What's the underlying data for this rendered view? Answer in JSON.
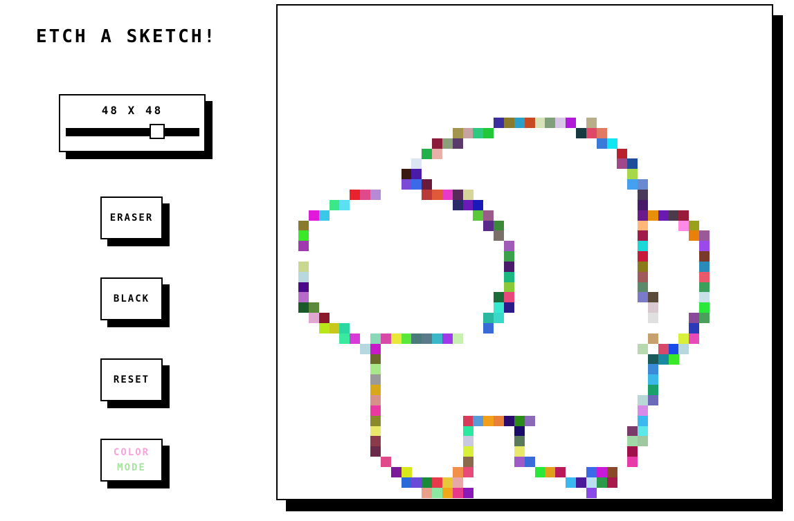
{
  "app": {
    "title": "ETCH A SKETCH!"
  },
  "grid_control": {
    "label": "48 X 48",
    "value": 48,
    "min": 1,
    "max": 100
  },
  "buttons": {
    "eraser": "ERASER",
    "black": "BLACK",
    "reset": "RESET",
    "color_mode_line1": "COLOR",
    "color_mode_line2": "MODE"
  },
  "colors": {
    "ink": "#000000",
    "background": "#ffffff"
  },
  "drawing": {
    "grid_size": 48,
    "cells": [
      [
        19,
        11,
        "#3b2f9e"
      ],
      [
        20,
        11,
        "#8a7a2e"
      ],
      [
        21,
        11,
        "#2aa0c8"
      ],
      [
        22,
        11,
        "#c84a22"
      ],
      [
        23,
        11,
        "#d6e2b8"
      ],
      [
        24,
        11,
        "#7fa07a"
      ],
      [
        25,
        11,
        "#d8c6e6"
      ],
      [
        26,
        11,
        "#b01ad8"
      ],
      [
        27,
        11,
        "#ffffff"
      ],
      [
        28,
        11,
        "#b8ae8a"
      ],
      [
        15,
        12,
        "#a3954e"
      ],
      [
        16,
        12,
        "#c8a2a0"
      ],
      [
        17,
        12,
        "#2ec880"
      ],
      [
        18,
        12,
        "#22c838"
      ],
      [
        27,
        12,
        "#173a40"
      ],
      [
        28,
        12,
        "#e04868"
      ],
      [
        29,
        12,
        "#e07a62"
      ],
      [
        13,
        13,
        "#8a1c3a"
      ],
      [
        14,
        13,
        "#8aa07a"
      ],
      [
        15,
        13,
        "#5a3a6a"
      ],
      [
        29,
        13,
        "#3a7ad8"
      ],
      [
        30,
        13,
        "#12e6f0"
      ],
      [
        12,
        14,
        "#22b04a"
      ],
      [
        13,
        14,
        "#e8b0a8"
      ],
      [
        31,
        14,
        "#b8222e"
      ],
      [
        11,
        15,
        "#dce6f2"
      ],
      [
        31,
        15,
        "#a0488a"
      ],
      [
        32,
        15,
        "#1e4e9a"
      ],
      [
        10,
        16,
        "#3a1a10"
      ],
      [
        11,
        16,
        "#4a1aa8"
      ],
      [
        32,
        16,
        "#a8d84a"
      ],
      [
        10,
        17,
        "#7a4ad6"
      ],
      [
        11,
        17,
        "#3a6ae8"
      ],
      [
        12,
        17,
        "#6a1a3a"
      ],
      [
        32,
        17,
        "#46a0f0"
      ],
      [
        33,
        17,
        "#6a8ad0"
      ],
      [
        5,
        18,
        "#e8222e"
      ],
      [
        6,
        18,
        "#e04a8a"
      ],
      [
        7,
        18,
        "#b88ad6"
      ],
      [
        12,
        18,
        "#b83a3a"
      ],
      [
        13,
        18,
        "#e05a3a"
      ],
      [
        14,
        18,
        "#e83ac8"
      ],
      [
        15,
        18,
        "#5a2a5a"
      ],
      [
        16,
        18,
        "#d6d69a"
      ],
      [
        33,
        18,
        "#4a3a5a"
      ],
      [
        3,
        19,
        "#3ae88a"
      ],
      [
        4,
        19,
        "#5ae0f0"
      ],
      [
        15,
        19,
        "#2a2a6a"
      ],
      [
        16,
        19,
        "#6a1ab8"
      ],
      [
        17,
        19,
        "#1a1ab8"
      ],
      [
        33,
        19,
        "#4a1a6a"
      ],
      [
        1,
        20,
        "#e01ad8"
      ],
      [
        2,
        20,
        "#3ac8e8"
      ],
      [
        17,
        20,
        "#5ac83a"
      ],
      [
        18,
        20,
        "#9a5a8a"
      ],
      [
        33,
        20,
        "#6a1a8a"
      ],
      [
        34,
        20,
        "#e8900a"
      ],
      [
        35,
        20,
        "#6a1ab0"
      ],
      [
        36,
        20,
        "#4a3a4a"
      ],
      [
        37,
        20,
        "#9a1a3a"
      ],
      [
        0,
        21,
        "#8a7a2e"
      ],
      [
        18,
        21,
        "#5a2a8a"
      ],
      [
        19,
        21,
        "#3a8a3a"
      ],
      [
        33,
        21,
        "#ffb878"
      ],
      [
        38,
        21,
        "#9aa01a"
      ],
      [
        37,
        21,
        "#ff8ae6"
      ],
      [
        0,
        22,
        "#3ae82a"
      ],
      [
        19,
        22,
        "#7a7068"
      ],
      [
        33,
        22,
        "#a01a4a"
      ],
      [
        38,
        22,
        "#e8800a"
      ],
      [
        39,
        22,
        "#9a5a9a"
      ],
      [
        0,
        23,
        "#a03ab0"
      ],
      [
        20,
        23,
        "#a05ab8"
      ],
      [
        33,
        23,
        "#1ad8d8"
      ],
      [
        39,
        23,
        "#9a4ae8"
      ],
      [
        20,
        24,
        "#3aa04a"
      ],
      [
        33,
        24,
        "#c81a3a"
      ],
      [
        39,
        24,
        "#7a3a2a"
      ],
      [
        0,
        25,
        "#c8d890"
      ],
      [
        20,
        25,
        "#4a1a6a"
      ],
      [
        33,
        25,
        "#8a7a1a"
      ],
      [
        39,
        25,
        "#2a8ab8"
      ],
      [
        0,
        26,
        "#b8d8e0"
      ],
      [
        20,
        26,
        "#1ab880"
      ],
      [
        33,
        26,
        "#a05a5a"
      ],
      [
        39,
        26,
        "#e85a6a"
      ],
      [
        0,
        27,
        "#4a0a8a"
      ],
      [
        20,
        27,
        "#8ac83a"
      ],
      [
        33,
        27,
        "#5a8a6a"
      ],
      [
        39,
        27,
        "#3aa05a"
      ],
      [
        0,
        28,
        "#b86ac8"
      ],
      [
        19,
        28,
        "#1a6a3a"
      ],
      [
        20,
        28,
        "#e8487a"
      ],
      [
        33,
        28,
        "#7a7ac8"
      ],
      [
        34,
        28,
        "#5a4a3a"
      ],
      [
        39,
        28,
        "#c8e0e8"
      ],
      [
        0,
        29,
        "#1a5a2a"
      ],
      [
        1,
        29,
        "#5a8a3a"
      ],
      [
        19,
        29,
        "#3ae8d0"
      ],
      [
        20,
        29,
        "#2a1a8a"
      ],
      [
        34,
        29,
        "#d8c8d0"
      ],
      [
        39,
        29,
        "#2ae83a"
      ],
      [
        1,
        30,
        "#e0a8d0"
      ],
      [
        2,
        30,
        "#8a1a2a"
      ],
      [
        18,
        30,
        "#2ab8a0"
      ],
      [
        19,
        30,
        "#3ad8c8"
      ],
      [
        34,
        30,
        "#e0e0e0"
      ],
      [
        38,
        30,
        "#8a4a9a"
      ],
      [
        39,
        30,
        "#4aa05a"
      ],
      [
        2,
        31,
        "#b8e81a"
      ],
      [
        3,
        31,
        "#c8c81a"
      ],
      [
        4,
        31,
        "#2ad8a0"
      ],
      [
        18,
        31,
        "#3a6ad8"
      ],
      [
        38,
        31,
        "#2a3ab8"
      ],
      [
        4,
        32,
        "#3ae8a0"
      ],
      [
        5,
        32,
        "#d83ad8"
      ],
      [
        7,
        32,
        "#8ad8b8"
      ],
      [
        8,
        32,
        "#d84aa8"
      ],
      [
        9,
        32,
        "#e8e83a"
      ],
      [
        10,
        32,
        "#5ae83a"
      ],
      [
        11,
        32,
        "#4a7a7a"
      ],
      [
        12,
        32,
        "#5a7a8a"
      ],
      [
        13,
        32,
        "#3ab8c8"
      ],
      [
        14,
        32,
        "#a03ae8"
      ],
      [
        15,
        32,
        "#c8f0b0"
      ],
      [
        34,
        32,
        "#c8a070"
      ],
      [
        37,
        32,
        "#d8f03a"
      ],
      [
        38,
        32,
        "#e84ab8"
      ],
      [
        6,
        33,
        "#b8d8e0"
      ],
      [
        7,
        33,
        "#c81ac8"
      ],
      [
        33,
        33,
        "#b8d8b0"
      ],
      [
        35,
        33,
        "#d8486a"
      ],
      [
        36,
        33,
        "#1a4ae8"
      ],
      [
        37,
        33,
        "#b8d8e0"
      ],
      [
        7,
        34,
        "#6a6a2a"
      ],
      [
        34,
        34,
        "#1a5a5a"
      ],
      [
        35,
        34,
        "#1a8aa0"
      ],
      [
        36,
        34,
        "#3ae82a"
      ],
      [
        7,
        35,
        "#a8e88a"
      ],
      [
        34,
        35,
        "#3a8ad8"
      ],
      [
        7,
        36,
        "#9a9a9a"
      ],
      [
        34,
        36,
        "#3ab8e8"
      ],
      [
        7,
        37,
        "#d8a81a"
      ],
      [
        34,
        37,
        "#1aa06a"
      ],
      [
        7,
        38,
        "#d8908a"
      ],
      [
        33,
        38,
        "#b8d8d8"
      ],
      [
        34,
        38,
        "#6a6ab8"
      ],
      [
        7,
        39,
        "#e83aa0"
      ],
      [
        33,
        39,
        "#d88ae8"
      ],
      [
        7,
        40,
        "#8a8a2a"
      ],
      [
        33,
        40,
        "#3ab8f0"
      ],
      [
        16,
        40,
        "#d83a5a"
      ],
      [
        17,
        40,
        "#5a9ad8"
      ],
      [
        18,
        40,
        "#f0a01a"
      ],
      [
        19,
        40,
        "#e8803a"
      ],
      [
        20,
        40,
        "#2a0a6a"
      ],
      [
        21,
        40,
        "#2a8a1a"
      ],
      [
        22,
        40,
        "#8a6ab8"
      ],
      [
        7,
        41,
        "#e8e86a"
      ],
      [
        16,
        41,
        "#2ae8a0"
      ],
      [
        21,
        41,
        "#1a0a6a"
      ],
      [
        32,
        41,
        "#7a3a6a"
      ],
      [
        33,
        41,
        "#5ae8e8"
      ],
      [
        7,
        42,
        "#8a3a4a"
      ],
      [
        16,
        42,
        "#c8c8e0"
      ],
      [
        21,
        42,
        "#5a7a5a"
      ],
      [
        32,
        42,
        "#a0d8a8"
      ],
      [
        33,
        42,
        "#a0c8a0"
      ],
      [
        7,
        43,
        "#6a2a4a"
      ],
      [
        16,
        43,
        "#d8f03a"
      ],
      [
        21,
        43,
        "#e8e86a"
      ],
      [
        32,
        43,
        "#a0104a"
      ],
      [
        8,
        44,
        "#e04a8a"
      ],
      [
        16,
        44,
        "#8a6a4a"
      ],
      [
        21,
        44,
        "#a05ac8"
      ],
      [
        22,
        44,
        "#3a6ad8"
      ],
      [
        32,
        44,
        "#e83aa8"
      ],
      [
        9,
        45,
        "#7a1a9a"
      ],
      [
        10,
        45,
        "#d8e81a"
      ],
      [
        15,
        45,
        "#f0904a"
      ],
      [
        16,
        45,
        "#e84a7a"
      ],
      [
        23,
        45,
        "#2ae83a"
      ],
      [
        24,
        45,
        "#e0a01a"
      ],
      [
        25,
        45,
        "#b81a5a"
      ],
      [
        28,
        45,
        "#3a6ae8"
      ],
      [
        29,
        45,
        "#c81ad8"
      ],
      [
        30,
        45,
        "#8a4a2a"
      ],
      [
        10,
        46,
        "#2a6ad8"
      ],
      [
        11,
        46,
        "#6a4ad8"
      ],
      [
        12,
        46,
        "#1a8a3a"
      ],
      [
        13,
        46,
        "#e83a4a"
      ],
      [
        14,
        46,
        "#e8c83a"
      ],
      [
        15,
        46,
        "#e8a8a8"
      ],
      [
        26,
        46,
        "#3ab8f0"
      ],
      [
        27,
        46,
        "#4a1a9a"
      ],
      [
        28,
        46,
        "#b8e0f0"
      ],
      [
        29,
        46,
        "#2a9a4a"
      ],
      [
        30,
        46,
        "#a81a4a"
      ],
      [
        12,
        47,
        "#e8a08a"
      ],
      [
        13,
        47,
        "#8ae8a0"
      ],
      [
        14,
        47,
        "#f0a81a"
      ],
      [
        15,
        47,
        "#e83a8a"
      ],
      [
        16,
        47,
        "#8a1ab8"
      ],
      [
        28,
        47,
        "#8a4ae8"
      ]
    ]
  }
}
